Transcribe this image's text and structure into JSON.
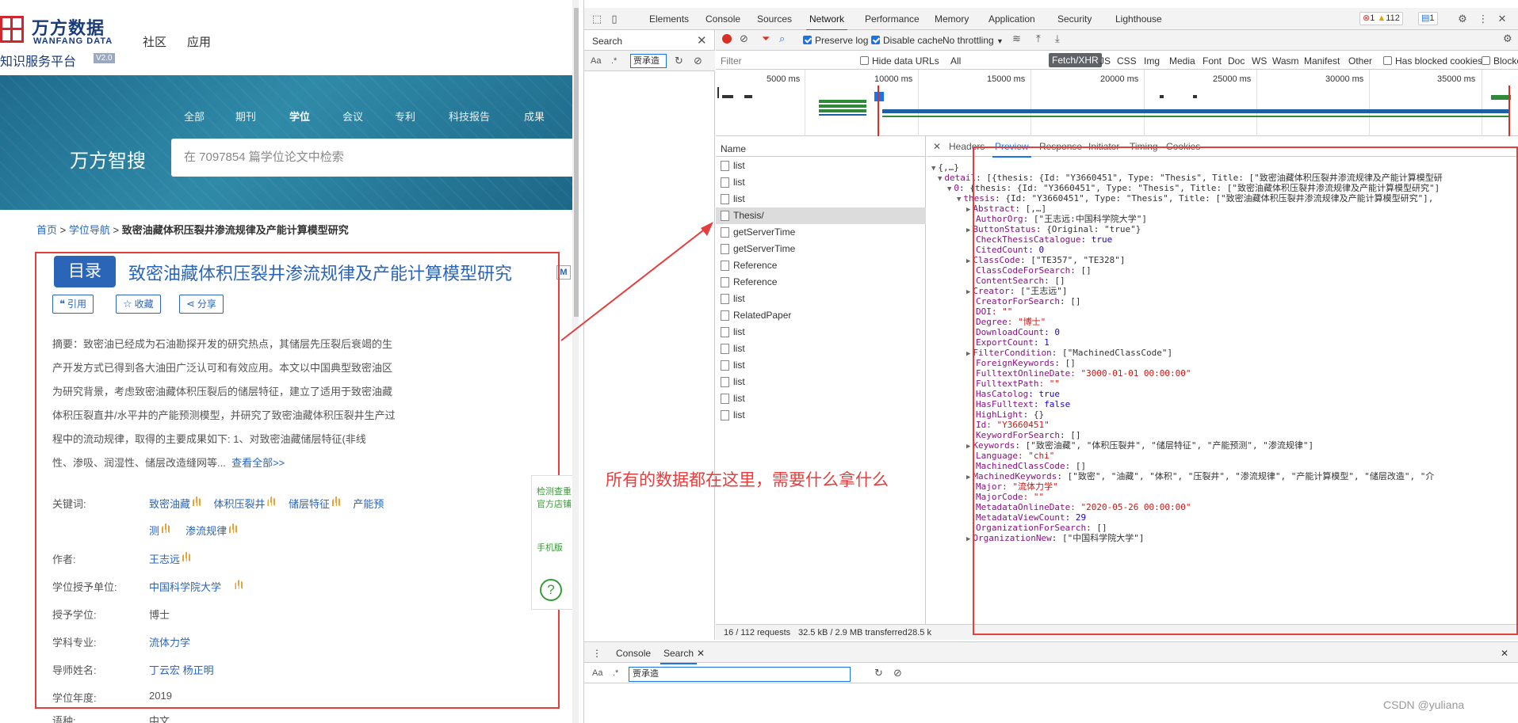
{
  "site": {
    "logo_cn": "万方数据",
    "logo_en": "WANFANG DATA",
    "platform": "知识服务平台",
    "version": "V2.0",
    "nav": [
      "社区",
      "应用"
    ],
    "hero_tabs": [
      "全部",
      "期刊",
      "学位",
      "会议",
      "专利",
      "科技报告",
      "成果"
    ],
    "hero_brand": "万方智搜",
    "search_placeholder": "在 7097854 篇学位论文中检索",
    "breadcrumb": {
      "home": "首页",
      "sep": ">",
      "nav": "学位导航",
      "current": "致密油藏体积压裂井渗流规律及产能计算模型研究"
    },
    "catalog_button": "目录",
    "title": "致密油藏体积压裂井渗流规律及产能计算模型研究",
    "m_badge": "M",
    "actions": {
      "cite": "引用",
      "collect": "收藏",
      "share": "分享"
    },
    "abstract_lines": [
      "摘要：致密油已经成为石油勘探开发的研究热点，其储层先压裂后衰竭的生",
      "产开发方式已得到各大油田广泛认可和有效应用。本文以中国典型致密油区",
      "为研究背景，考虑致密油藏体积压裂后的储层特征，建立了适用于致密油藏",
      "体积压裂直井/水平井的产能预测模型，并研究了致密油藏体积压裂井生产过",
      "程中的流动规律，取得的主要成果如下:      1、对致密油藏储层特征(非线"
    ],
    "abstract_last": "性、渗吸、润湿性、储层改造缝网等...",
    "view_all": "查看全部>>",
    "meta": {
      "keywords_label": "关键词:",
      "keywords": [
        "致密油藏",
        "体积压裂井",
        "储层特征",
        "产能预",
        "测",
        "渗流规律"
      ],
      "author_label": "作者:",
      "author": "王志远",
      "unit_label": "学位授予单位:",
      "unit": "中国科学院大学",
      "degree_label": "授予学位:",
      "degree": "博士",
      "major_label": "学科专业:",
      "major": "流体力学",
      "advisor_label": "导师姓名:",
      "advisor": "丁云宏 杨正明",
      "year_label": "学位年度:",
      "year": "2019",
      "lang_label": "语种:",
      "lang": "中文"
    },
    "side_float": {
      "t1a": "检测查重",
      "t1b": "官方店铺",
      "t2": "手机版",
      "help": "?"
    }
  },
  "devtools": {
    "tabs": [
      "Elements",
      "Console",
      "Sources",
      "Network",
      "Performance",
      "Memory",
      "Application",
      "Security",
      "Lighthouse"
    ],
    "active_tab": "Network",
    "badges": {
      "errors": "1",
      "warnings": "112",
      "messages": "1"
    },
    "search_panel": {
      "title": "Search",
      "case": "Aa",
      "regex": ".*",
      "query": "贾承造"
    },
    "toolbar": {
      "preserve_log": "Preserve log",
      "disable_cache": "Disable cache",
      "throttling": "No throttling"
    },
    "filter": {
      "placeholder": "Filter",
      "hide_data_urls": "Hide data URLs",
      "types": [
        "All",
        "Fetch/XHR",
        "JS",
        "CSS",
        "Img",
        "Media",
        "Font",
        "Doc",
        "WS",
        "Wasm",
        "Manifest",
        "Other"
      ],
      "active_type": "Fetch/XHR",
      "has_blocked_cookies": "Has blocked cookies",
      "blocked_requests": "Blocked Requests"
    },
    "timeline_ticks": [
      "5000 ms",
      "10000 ms",
      "15000 ms",
      "20000 ms",
      "25000 ms",
      "30000 ms",
      "35000 ms"
    ],
    "name_header": "Name",
    "requests": [
      "list",
      "list",
      "list",
      "Thesis/",
      "getServerTime",
      "getServerTime",
      "Reference",
      "Reference",
      "list",
      "RelatedPaper",
      "list",
      "list",
      "list",
      "list",
      "list",
      "list"
    ],
    "selected_request": "Thesis/",
    "status": {
      "requests": "16 / 112 requests",
      "transferred": "32.5 kB / 2.9 MB transferred",
      "resources": "28.5 k"
    },
    "preview_tabs": [
      "Headers",
      "Preview",
      "Response",
      "Initiator",
      "Timing",
      "Cookies"
    ],
    "active_preview_tab": "Preview",
    "json_lines": [
      "{,…}",
      "detail: [{thesis: {Id: \"Y3660451\", Type: \"Thesis\", Title: [\"致密油藏体积压裂井渗流规律及产能计算模型研",
      "0: {thesis: {Id: \"Y3660451\", Type: \"Thesis\", Title: [\"致密油藏体积压裂井渗流规律及产能计算模型研究\"]",
      "thesis: {Id: \"Y3660451\", Type: \"Thesis\", Title: [\"致密油藏体积压裂井渗流规律及产能计算模型研究\"],",
      "Abstract: [,…]",
      "AuthorOrg: [\"王志远:中国科学院大学\"]",
      "ButtonStatus: {Original: \"true\"}",
      "CheckThesisCatalogue: true",
      "CitedCount: 0",
      "ClassCode: [\"TE357\", \"TE328\"]",
      "ClassCodeForSearch: []",
      "ContentSearch: []",
      "Creator: [\"王志远\"]",
      "CreatorForSearch: []",
      "DOI: \"\"",
      "Degree: \"博士\"",
      "DownloadCount: 0",
      "ExportCount: 1",
      "FilterCondition: [\"MachinedClassCode\"]",
      "ForeignKeywords: []",
      "FulltextOnlineDate: \"3000-01-01 00:00:00\"",
      "FulltextPath: \"\"",
      "HasCatolog: true",
      "HasFulltext: false",
      "HighLight: {}",
      "Id: \"Y3660451\"",
      "KeywordForSearch: []",
      "Keywords: [\"致密油藏\", \"体积压裂井\", \"储层特征\", \"产能预测\", \"渗流规律\"]",
      "Language: \"chi\"",
      "MachinedClassCode: []",
      "MachinedKeywords: [\"致密\", \"油藏\", \"体积\", \"压裂井\", \"渗流规律\", \"产能计算模型\", \"储层改造\", \"介",
      "Major: \"流体力学\"",
      "MajorCode: \"\"",
      "MetadataOnlineDate: \"2020-05-26 00:00:00\"",
      "MetadataViewCount: 29",
      "OrganizationForSearch: []",
      "OrganizationNew: [\"中国科学院大学\"]"
    ],
    "bottom_tabs": [
      "Console",
      "Search"
    ],
    "bottom_search": "贾承造"
  },
  "annotation": "所有的数据都在这里，需要什么拿什么",
  "watermark": "CSDN @yuliana",
  "colors": {
    "accent_red": "#e43e3e",
    "link_blue": "#2a65b8",
    "devtools_blue": "#1a73e8"
  }
}
